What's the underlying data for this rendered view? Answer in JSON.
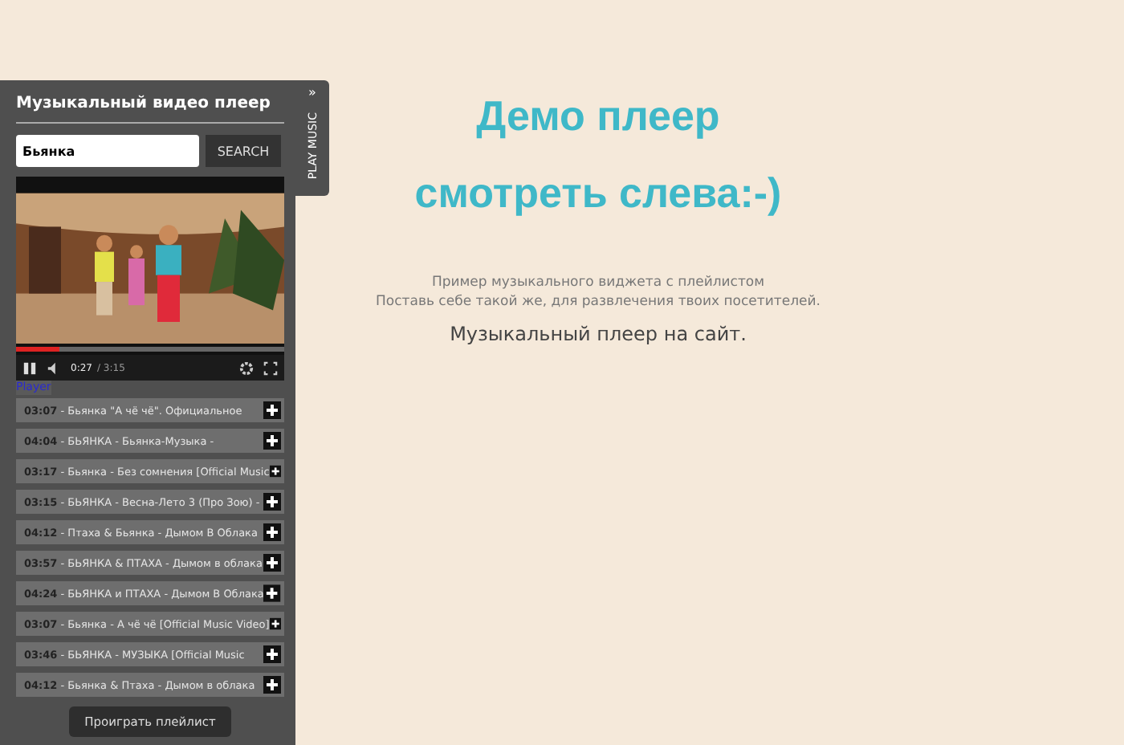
{
  "panel": {
    "title": "Музыкальный видео плеер",
    "search": {
      "value": "Бьянка",
      "button": "SEARCH"
    },
    "side_tab": {
      "arrows": "»",
      "label": "PLAY MUSIC"
    },
    "video": {
      "progress": {
        "level": 0.16
      },
      "time": "0:27",
      "duration": "/ 3:15",
      "playing": true
    },
    "player_link": "Player",
    "playlist": [
      {
        "time": "03:07",
        "title": "- Бьянка \"А чё чё\". Официальное"
      },
      {
        "time": "04:04",
        "title": "- БЬЯНКА - Бьянка-Музыка -"
      },
      {
        "time": "03:17",
        "title": "- Бьянка - Без сомнения [Official Music"
      },
      {
        "time": "03:15",
        "title": "- БЬЯНКА - Весна-Лето 3 (Про Зою) -"
      },
      {
        "time": "04:12",
        "title": "- Птаха & Бьянка - Дымом В Облака"
      },
      {
        "time": "03:57",
        "title": "- БЬЯНКА & ПТАХА - Дымом в облака"
      },
      {
        "time": "04:24",
        "title": "- БЬЯНКА и ПТАХА - Дымом В Облака"
      },
      {
        "time": "03:07",
        "title": "- Бьянка - А чё чё [Official Music Video]"
      },
      {
        "time": "03:46",
        "title": "- БЬЯНКА - МУЗЫКА [Official Music"
      },
      {
        "time": "04:12",
        "title": "- Бьянка & Птаха - Дымом в облака"
      }
    ],
    "play_button": "Проиграть плейлист"
  },
  "content": {
    "headings": [
      "Демо плеер",
      "смотреть слева:-)"
    ],
    "lines": [
      "Пример музыкального виджета с плейлистом",
      "Поставь себе такой же, для развлечения твоих посетителей."
    ],
    "tagline": "Музыкальный плеер на сайт."
  }
}
